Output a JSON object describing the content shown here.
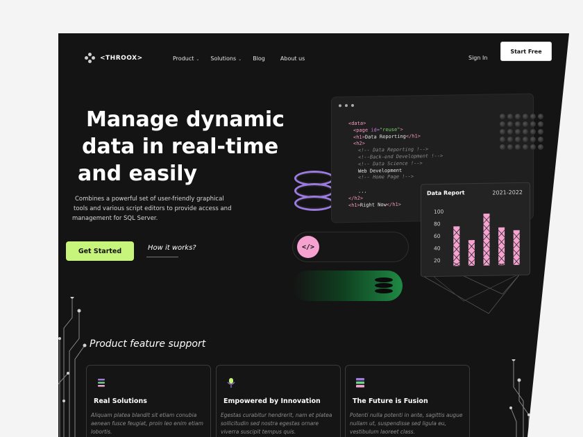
{
  "nav": {
    "brand": "<THROOX>",
    "items": [
      {
        "label": "Product",
        "dropdown": true
      },
      {
        "label": "Solutions",
        "dropdown": true
      },
      {
        "label": "Blog",
        "dropdown": false
      },
      {
        "label": "About us",
        "dropdown": false
      }
    ],
    "sign_in": "Sign In",
    "start_free": "Start Free"
  },
  "hero": {
    "title_lines": [
      "Manage dynamic",
      "data in real-time",
      "and easily"
    ],
    "subtitle_lines": [
      "Combines a powerful set of user-friendly graphical",
      "tools and various script editors to provide access and",
      "management for SQL Server."
    ],
    "primary_cta": "Get Started",
    "secondary_cta": "How it works?"
  },
  "code_window": {
    "lines": [
      {
        "indent": 0,
        "parts": [
          {
            "c": "tag",
            "t": "<data>"
          }
        ]
      },
      {
        "indent": 1,
        "parts": [
          {
            "c": "tag",
            "t": "<page "
          },
          {
            "c": "attr",
            "t": "id="
          },
          {
            "c": "val",
            "t": "\"reuse\""
          },
          {
            "c": "tag",
            "t": ">"
          }
        ]
      },
      {
        "indent": 1,
        "parts": [
          {
            "c": "tag",
            "t": "<h1>"
          },
          {
            "c": "txt",
            "t": "Data Reporting"
          },
          {
            "c": "tag",
            "t": "</h1>"
          }
        ]
      },
      {
        "indent": 1,
        "parts": [
          {
            "c": "tag",
            "t": "<h2>"
          }
        ]
      },
      {
        "indent": 2,
        "parts": [
          {
            "c": "cmt",
            "t": "<!-- Data Reporting !-->"
          }
        ]
      },
      {
        "indent": 2,
        "parts": [
          {
            "c": "cmt",
            "t": "<!--Back-end Development !-->"
          }
        ]
      },
      {
        "indent": 2,
        "parts": [
          {
            "c": "cmt",
            "t": "<!-- Data Science !-->"
          }
        ]
      },
      {
        "indent": 2,
        "parts": [
          {
            "c": "txt",
            "t": "Web Development"
          }
        ]
      },
      {
        "indent": 2,
        "parts": [
          {
            "c": "cmt",
            "t": "<!-- Home Page !-->"
          }
        ]
      },
      {
        "indent": 0,
        "parts": [
          {
            "c": "txt",
            "t": ""
          }
        ]
      },
      {
        "indent": 2,
        "parts": [
          {
            "c": "txt",
            "t": "..."
          }
        ]
      },
      {
        "indent": 0,
        "parts": [
          {
            "c": "tag",
            "t": "</h2>"
          }
        ]
      },
      {
        "indent": 0,
        "parts": [
          {
            "c": "tag",
            "t": "<h1>"
          },
          {
            "c": "txt",
            "t": "Right Now"
          },
          {
            "c": "tag",
            "t": "</h1>"
          }
        ]
      }
    ]
  },
  "code_button": {
    "icon": "code-icon",
    "glyph": "</>"
  },
  "chart_data": {
    "type": "bar",
    "title": "Data Report",
    "subtitle": "2021-2022",
    "yticks": [
      100,
      80,
      60,
      40,
      20
    ],
    "ylim": [
      10,
      110
    ],
    "values": [
      75,
      52,
      95,
      72,
      67
    ],
    "color": "#f6a2d0"
  },
  "features": {
    "title": "Product feature support",
    "cards": [
      {
        "icon": "stack-icon",
        "title": "Real Solutions",
        "text": "Aliquam platea blandit sit etiam conubia aenean fusce feugiat, proin leo enim etiam lobortis."
      },
      {
        "icon": "microphone-icon",
        "title": "Empowered by Innovation",
        "text": "Egestas curabitur hendrerit, nam et platea sollicitudin sed nostra egestas ornare viverra suscipit tempus quis."
      },
      {
        "icon": "server-icon",
        "title": "The Future is Fusion",
        "text": "Potenti nulla potenti in ante, sagittis augue nullam ut, suspendisse sed ligula eu, vestibulum laoreet class."
      }
    ]
  },
  "colors": {
    "accent_green": "#c7f57c",
    "accent_pink": "#f6a2d0",
    "background": "#141414"
  }
}
